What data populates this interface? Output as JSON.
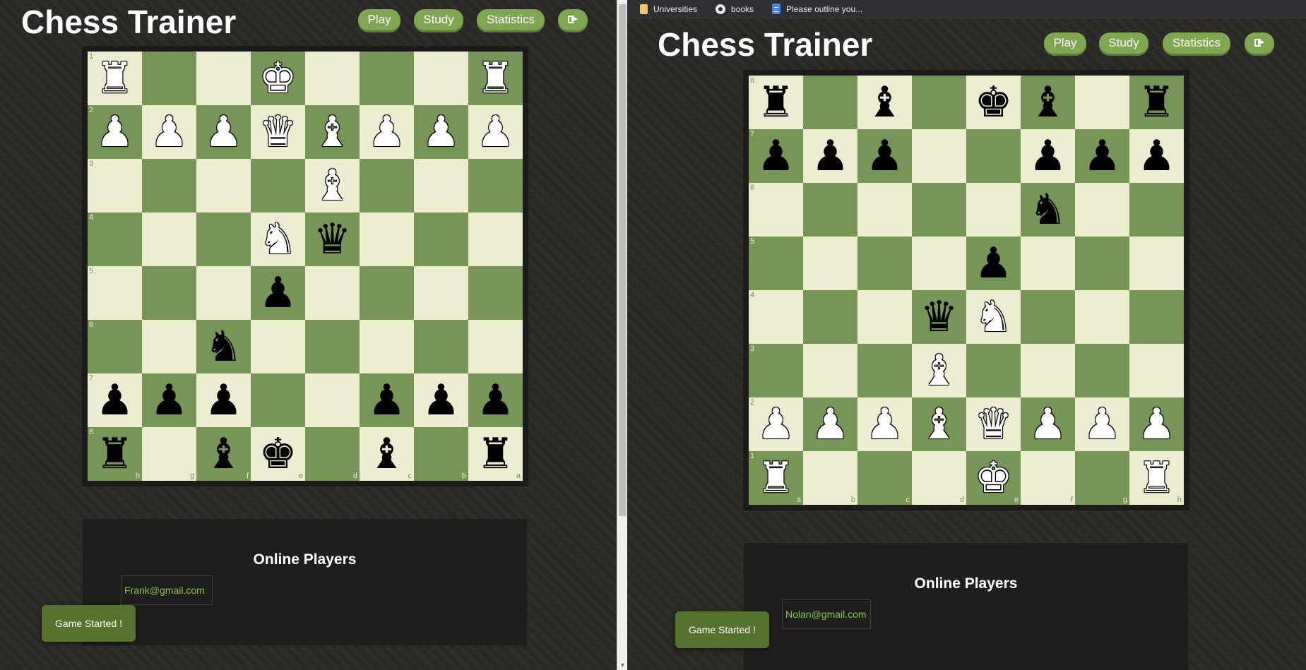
{
  "browser": {
    "bookmarks": [
      {
        "label": "Universities",
        "icon": "folder-icon"
      },
      {
        "label": "books",
        "icon": "github-icon"
      },
      {
        "label": "Please outline you...",
        "icon": "docs-icon"
      }
    ]
  },
  "windows": [
    {
      "title": "Chess Trainer",
      "nav": {
        "play": "Play",
        "study": "Study",
        "statistics": "Statistics",
        "logout_icon": "sign-out-icon"
      },
      "orientation": "black",
      "ranks_top_to_bottom": [
        "1",
        "2",
        "3",
        "4",
        "5",
        "6",
        "7",
        "8"
      ],
      "files_left_to_right": [
        "h",
        "g",
        "f",
        "e",
        "d",
        "c",
        "b",
        "a"
      ],
      "board": [
        [
          "wR",
          "",
          "",
          "wK",
          "",
          "",
          "",
          "wR"
        ],
        [
          "wP",
          "wP",
          "wP",
          "wQ",
          "wB",
          "wP",
          "wP",
          "wP"
        ],
        [
          "",
          "",
          "",
          "",
          "wB",
          "",
          "",
          ""
        ],
        [
          "",
          "",
          "",
          "wN",
          "bQ",
          "",
          "",
          ""
        ],
        [
          "",
          "",
          "",
          "bP",
          "",
          "",
          "",
          ""
        ],
        [
          "",
          "",
          "bN",
          "",
          "",
          "",
          "",
          ""
        ],
        [
          "bP",
          "bP",
          "bP",
          "",
          "",
          "bP",
          "bP",
          "bP"
        ],
        [
          "bR",
          "",
          "bB",
          "bK",
          "",
          "bB",
          "",
          "bR"
        ]
      ],
      "online_players": {
        "title": "Online Players",
        "players": [
          "Frank@gmail.com"
        ]
      },
      "toast": "Game Started !"
    },
    {
      "title": "Chess Trainer",
      "nav": {
        "play": "Play",
        "study": "Study",
        "statistics": "Statistics",
        "logout_icon": "sign-out-icon"
      },
      "orientation": "white",
      "ranks_top_to_bottom": [
        "8",
        "7",
        "6",
        "5",
        "4",
        "3",
        "2",
        "1"
      ],
      "files_left_to_right": [
        "a",
        "b",
        "c",
        "d",
        "e",
        "f",
        "g",
        "h"
      ],
      "board": [
        [
          "bR",
          "",
          "bB",
          "",
          "bK",
          "bB",
          "",
          "bR"
        ],
        [
          "bP",
          "bP",
          "bP",
          "",
          "",
          "bP",
          "bP",
          "bP"
        ],
        [
          "",
          "",
          "",
          "",
          "",
          "bN",
          "",
          ""
        ],
        [
          "",
          "",
          "",
          "",
          "bP",
          "",
          "",
          ""
        ],
        [
          "",
          "",
          "",
          "bQ",
          "wN",
          "",
          "",
          ""
        ],
        [
          "",
          "",
          "",
          "wB",
          "",
          "",
          "",
          ""
        ],
        [
          "wP",
          "wP",
          "wP",
          "wB",
          "wQ",
          "wP",
          "wP",
          "wP"
        ],
        [
          "wR",
          "",
          "",
          "",
          "wK",
          "",
          "",
          "wR"
        ]
      ],
      "online_players": {
        "title": "Online Players",
        "players": [
          "Nolan@gmail.com"
        ]
      },
      "toast": "Game Started !"
    }
  ],
  "colors": {
    "light_square": "#ebecd0",
    "dark_square": "#779556",
    "button": "#7fa650",
    "toast": "#55732f",
    "player_text": "#8fbf4f"
  }
}
